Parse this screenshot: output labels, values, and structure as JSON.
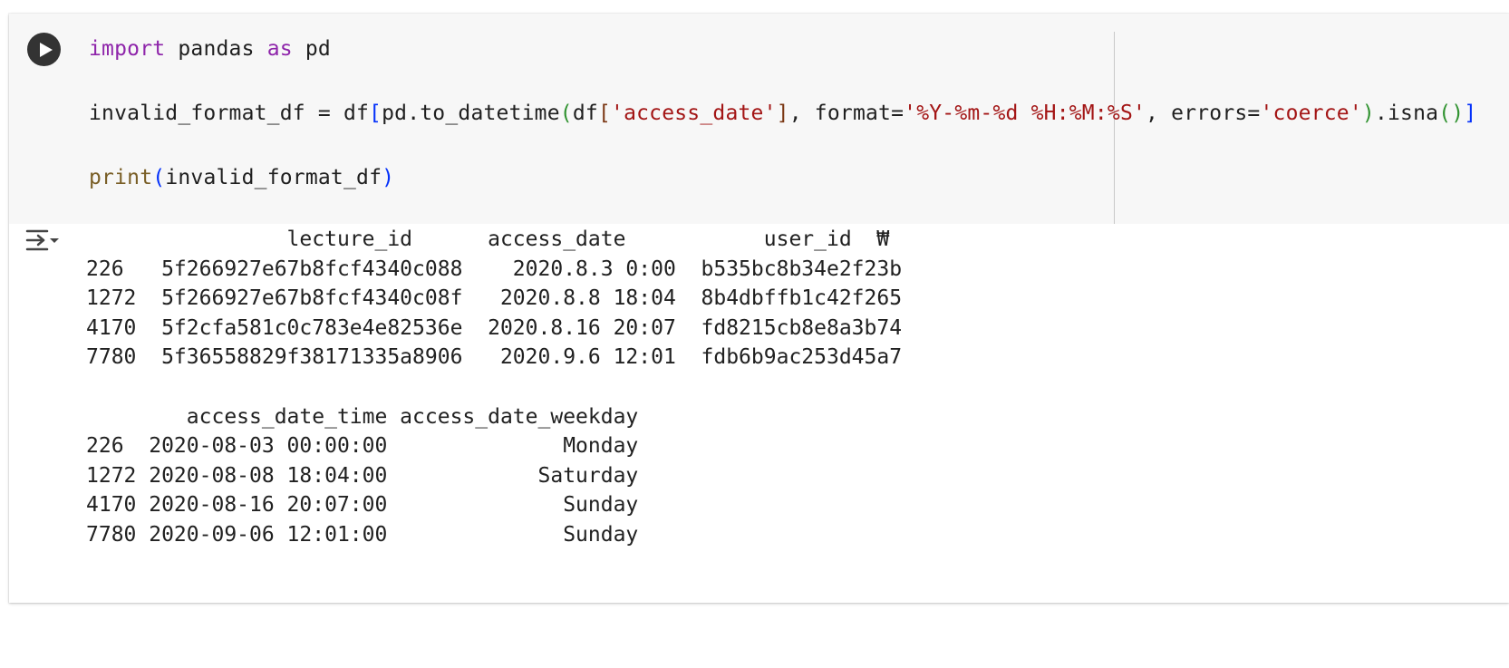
{
  "code": {
    "line1": {
      "kw_import": "import",
      "mod": " pandas ",
      "kw_as": "as",
      "alias": " pd"
    },
    "line2": {
      "p1": "invalid_format_df = df",
      "p2": "[",
      "p3": "pd.to_datetime",
      "p4": "(",
      "p5": "df",
      "p6": "[",
      "p7": "'access_date'",
      "p8": "]",
      "p9": ", format=",
      "p10": "'%Y-%m-%d %H:%M:%S'",
      "p11": ", errors=",
      "p12": "'coerce'",
      "p13": ")",
      "p14": ".isna",
      "p15": "()",
      "p16": "]"
    },
    "line3": {
      "fn": "print",
      "open": "(",
      "arg": "invalid_format_df",
      "close": ")"
    }
  },
  "output": {
    "lines": [
      "                lecture_id      access_date           user_id  ₩",
      "226   5f266927e67b8fcf4340c088    2020.8.3 0:00  b535bc8b34e2f23b",
      "1272  5f266927e67b8fcf4340c08f   2020.8.8 18:04  8b4dbffb1c42f265",
      "4170  5f2cfa581c0c783e4e82536e  2020.8.16 20:07  fd8215cb8e8a3b74",
      "7780  5f36558829f38171335a8906   2020.9.6 12:01  fdb6b9ac253d45a7",
      "",
      "        access_date_time access_date_weekday",
      "226  2020-08-03 00:00:00              Monday",
      "1272 2020-08-08 18:04:00            Saturday",
      "4170 2020-08-16 20:07:00              Sunday",
      "7780 2020-09-06 12:01:00              Sunday"
    ]
  },
  "icons": {
    "run": "play-icon",
    "output": "output-collapse-icon"
  },
  "colors": {
    "keyword": "#8e24aa",
    "string": "#a31515",
    "function": "#795e26",
    "bracket_level1": "#0431fa",
    "bracket_level2": "#319331",
    "bracket_level3": "#7b3814"
  }
}
